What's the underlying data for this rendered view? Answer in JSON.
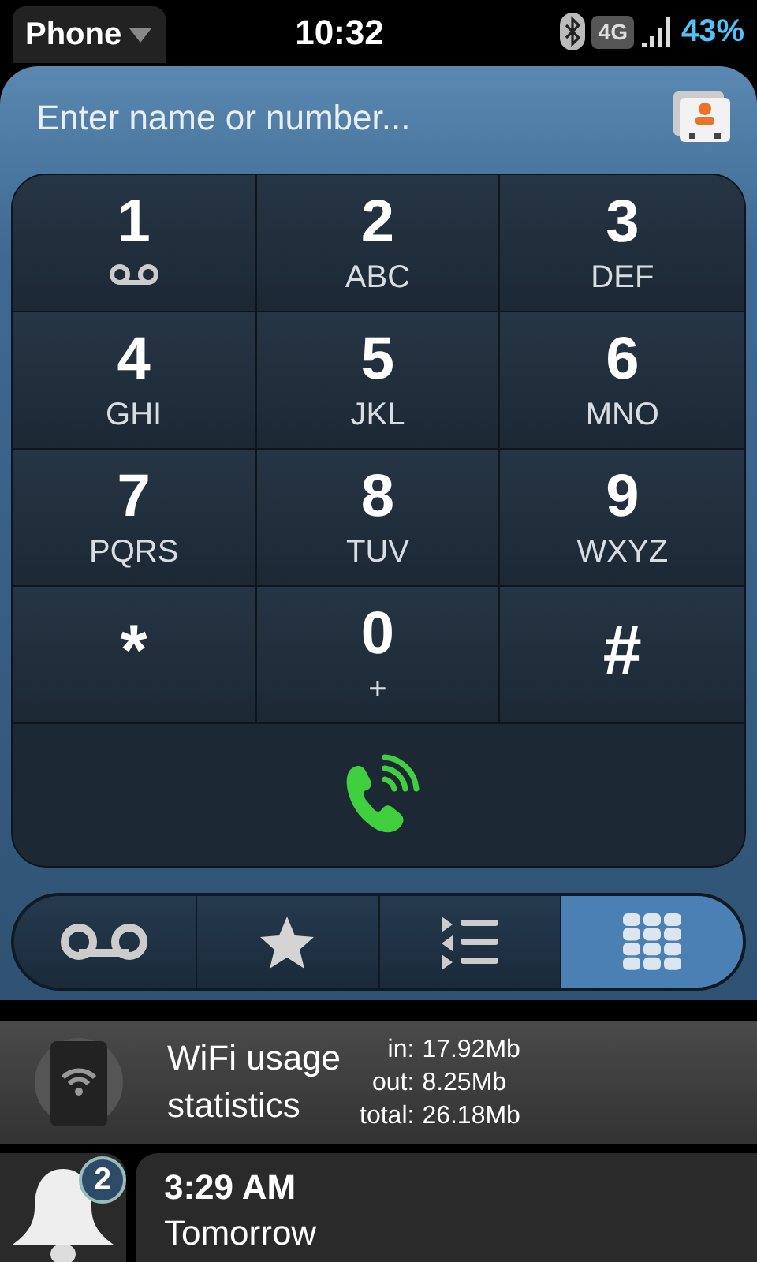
{
  "status_bar": {
    "app": "Phone",
    "time": "10:32",
    "network": "4G",
    "battery": "43%"
  },
  "search": {
    "placeholder": "Enter name or number..."
  },
  "keypad": [
    {
      "digit": "1",
      "kind": "voicemail"
    },
    {
      "digit": "2",
      "kind": "letters",
      "letters": "ABC"
    },
    {
      "digit": "3",
      "kind": "letters",
      "letters": "DEF"
    },
    {
      "digit": "4",
      "kind": "letters",
      "letters": "GHI"
    },
    {
      "digit": "5",
      "kind": "letters",
      "letters": "JKL"
    },
    {
      "digit": "6",
      "kind": "letters",
      "letters": "MNO"
    },
    {
      "digit": "7",
      "kind": "letters",
      "letters": "PQRS"
    },
    {
      "digit": "8",
      "kind": "letters",
      "letters": "TUV"
    },
    {
      "digit": "9",
      "kind": "letters",
      "letters": "WXYZ"
    },
    {
      "digit": "*",
      "kind": "symbol"
    },
    {
      "digit": "0",
      "kind": "letters",
      "letters": "+"
    },
    {
      "digit": "#",
      "kind": "symbol"
    }
  ],
  "tabs": [
    {
      "kind": "voicemail",
      "selected": false
    },
    {
      "kind": "favorites",
      "selected": false
    },
    {
      "kind": "calllog",
      "selected": false
    },
    {
      "kind": "dialpad",
      "selected": true
    }
  ],
  "notifications": [
    {
      "kind": "wifi",
      "title": "WiFi usage statistics",
      "stats": [
        {
          "label": "in:",
          "value": "17.92Mb"
        },
        {
          "label": "out:",
          "value": "8.25Mb"
        },
        {
          "label": "total:",
          "value": "26.18Mb"
        }
      ]
    }
  ],
  "alarm": {
    "badge": "2",
    "time": "3:29 AM",
    "day": "Tomorrow"
  }
}
